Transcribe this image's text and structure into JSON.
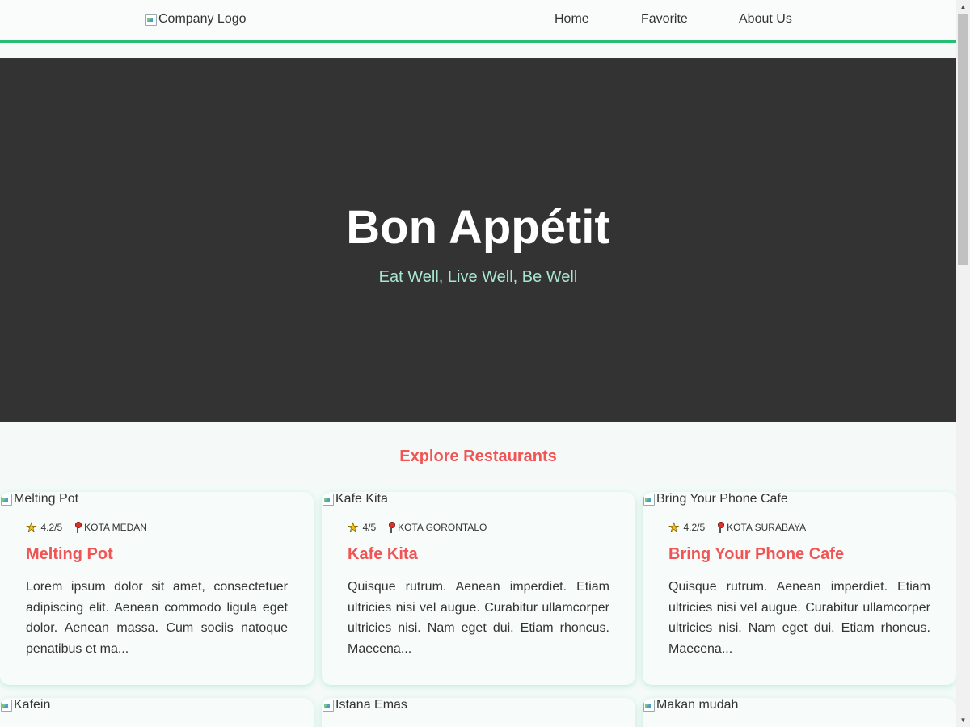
{
  "header": {
    "logo_alt": "Company Logo",
    "nav": [
      "Home",
      "Favorite",
      "About Us"
    ],
    "accent_color": "#22bf73"
  },
  "hero": {
    "title": "Bon Appétit",
    "subtitle": "Eat Well, Live Well, Be Well"
  },
  "section": {
    "title": "Explore Restaurants"
  },
  "restaurants": [
    {
      "img_alt": "Melting Pot",
      "rating": "4.2/5",
      "city": "KOTA MEDAN",
      "name": "Melting Pot",
      "description": "Lorem ipsum dolor sit amet, consectetuer adipiscing elit. Aenean commodo ligula eget dolor. Aenean massa. Cum sociis natoque penatibus et ma..."
    },
    {
      "img_alt": "Kafe Kita",
      "rating": "4/5",
      "city": "KOTA GORONTALO",
      "name": "Kafe Kita",
      "description": "Quisque rutrum. Aenean imperdiet. Etiam ultricies nisi vel augue. Curabitur ullamcorper ultricies nisi. Nam eget dui. Etiam rhoncus. Maecena..."
    },
    {
      "img_alt": "Bring Your Phone Cafe",
      "rating": "4.2/5",
      "city": "KOTA SURABAYA",
      "name": "Bring Your Phone Cafe",
      "description": "Quisque rutrum. Aenean imperdiet. Etiam ultricies nisi vel augue. Curabitur ullamcorper ultricies nisi. Nam eget dui. Etiam rhoncus. Maecena..."
    },
    {
      "img_alt": "Kafein"
    },
    {
      "img_alt": "Istana Emas"
    },
    {
      "img_alt": "Makan mudah"
    }
  ]
}
